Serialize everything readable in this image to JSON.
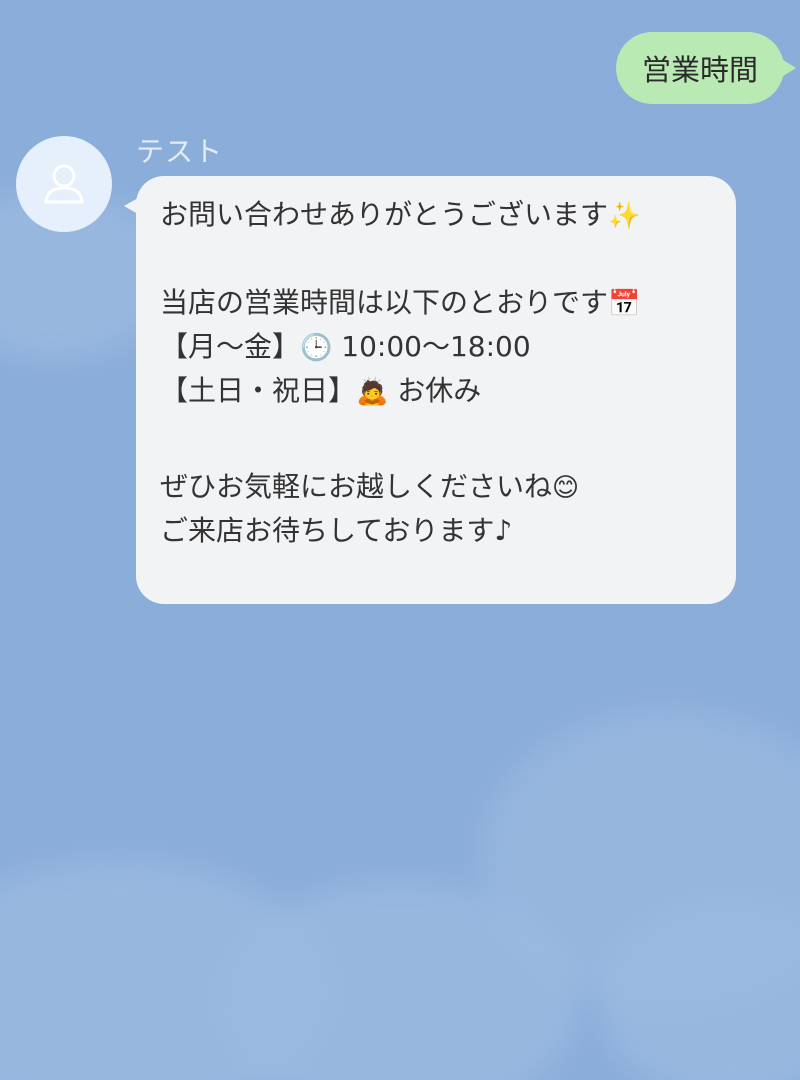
{
  "sent_message": {
    "text": "営業時間"
  },
  "received_message": {
    "sender_name": "テスト",
    "avatar_icon": "person-icon",
    "lines": {
      "l1": "お問い合わせありがとうございます",
      "l1_emoji": "✨",
      "l2": "当店の営業時間は以下のとおりです",
      "l2_emoji": "📅",
      "l3_prefix": "【月〜金】",
      "l3_emoji": "🕒",
      "l3_time": "10:00〜18:00",
      "l4_prefix": "【土日・祝日】",
      "l4_emoji": "🙇",
      "l4_text": "お休み",
      "l5": "ぜひお気軽にお越しくださいね",
      "l5_emoji": "😊",
      "l6": "ご来店お待ちしております♪"
    }
  },
  "colors": {
    "background": "#8badd9",
    "sent_bubble": "#b9eab3",
    "received_bubble": "#f2f3f5",
    "avatar_bg": "#e6f0fc"
  }
}
